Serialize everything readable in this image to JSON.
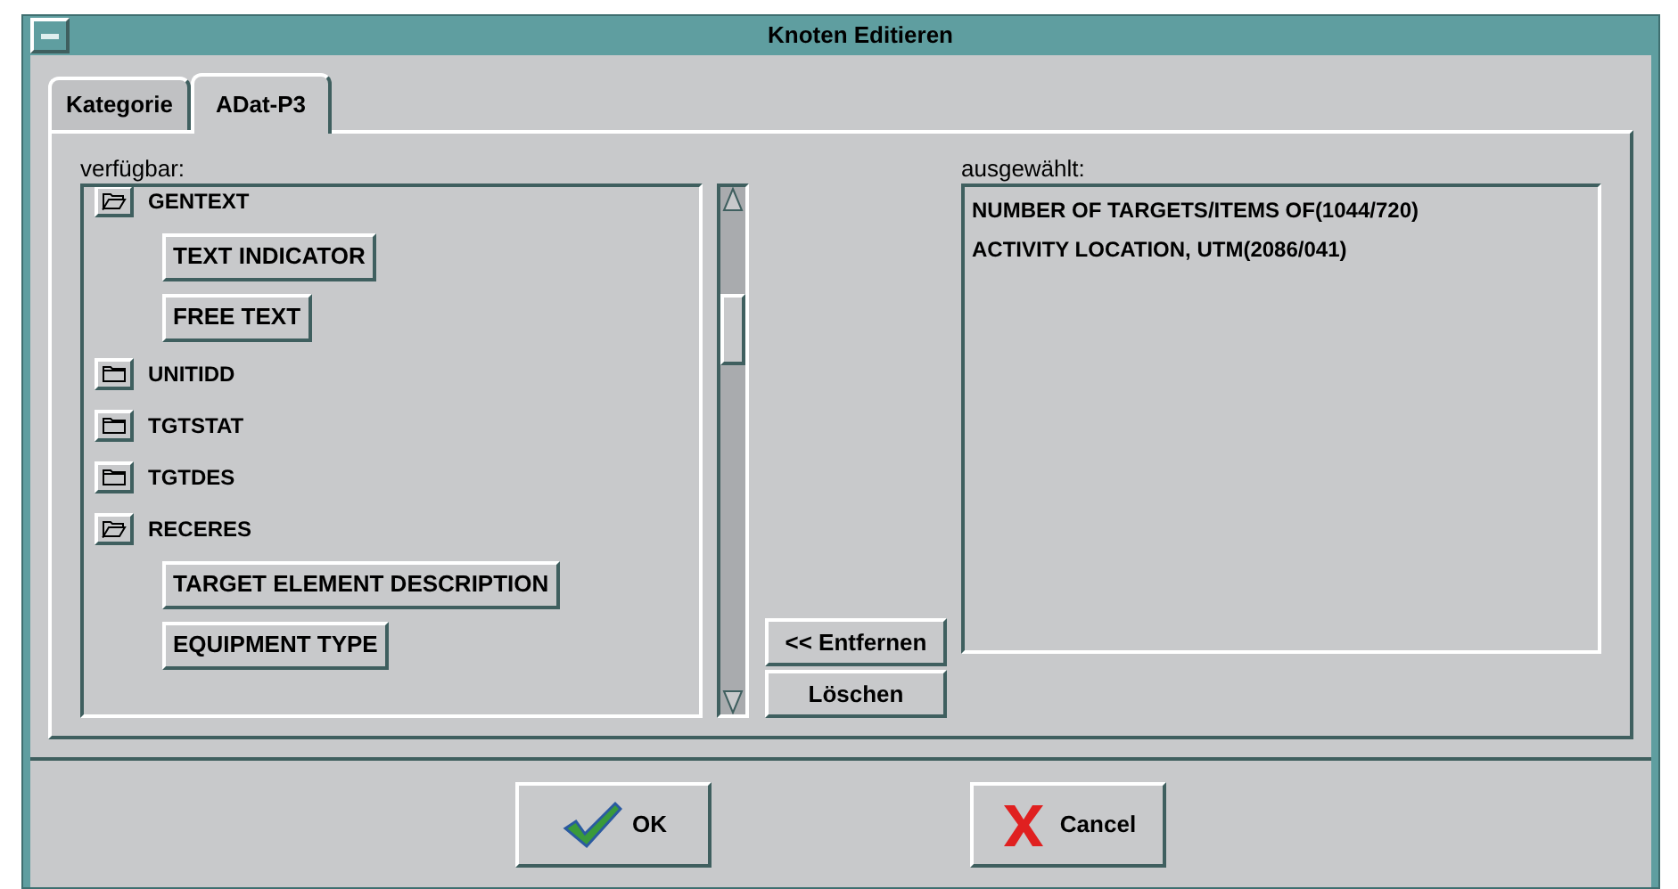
{
  "window": {
    "title": "Knoten Editieren"
  },
  "tabs": [
    {
      "label": "Kategorie",
      "selected": false
    },
    {
      "label": "ADat-P3",
      "selected": true
    }
  ],
  "available": {
    "label": "verfügbar:",
    "items": [
      {
        "label": "GENTEXT",
        "expanded": true,
        "children": [
          {
            "label": "TEXT INDICATOR"
          },
          {
            "label": "FREE TEXT"
          }
        ]
      },
      {
        "label": "UNITIDD",
        "expanded": false
      },
      {
        "label": "TGTSTAT",
        "expanded": false
      },
      {
        "label": "TGTDES",
        "expanded": false
      },
      {
        "label": "RECERES",
        "expanded": true,
        "children": [
          {
            "label": "TARGET ELEMENT DESCRIPTION"
          },
          {
            "label": "EQUIPMENT TYPE"
          }
        ]
      }
    ]
  },
  "middle_buttons": [
    "<< Entfernen",
    "Löschen"
  ],
  "selected_list": {
    "label": "ausgewählt:",
    "items": [
      "NUMBER OF TARGETS/ITEMS OF(1044/720)",
      "ACTIVITY LOCATION, UTM(2086/041)"
    ]
  },
  "dialog_buttons": [
    {
      "label": "OK",
      "kind": "ok"
    },
    {
      "label": "Cancel",
      "kind": "cancel"
    }
  ]
}
